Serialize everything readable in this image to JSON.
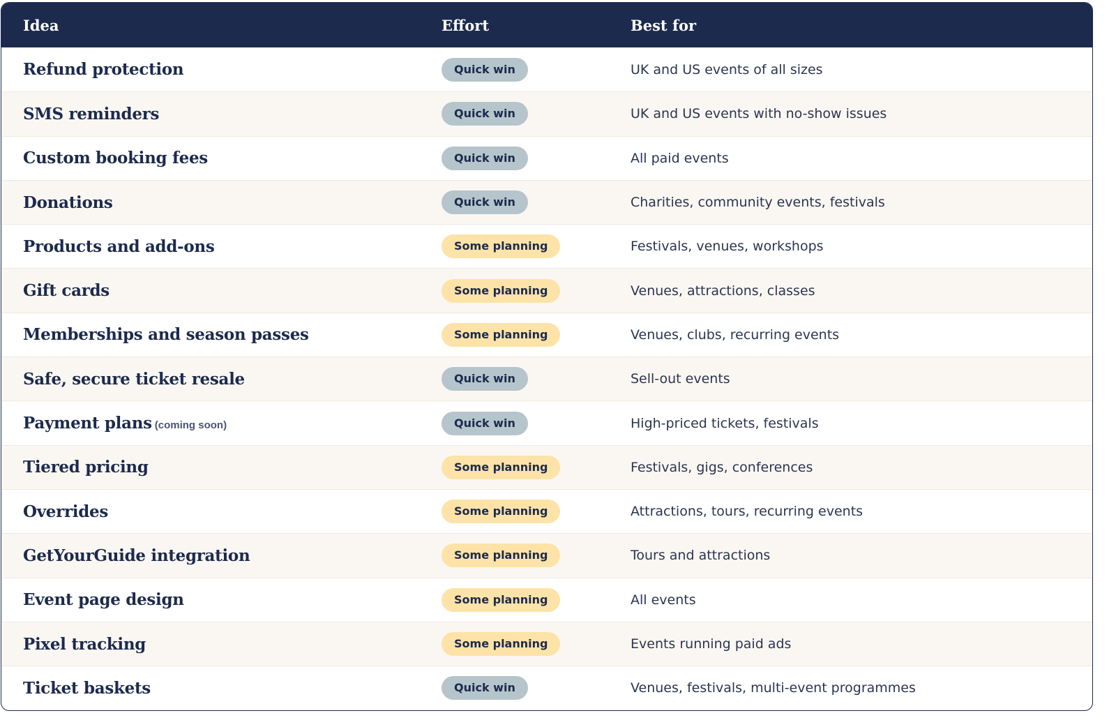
{
  "header": {
    "idea": "Idea",
    "effort": "Effort",
    "best_for": "Best for"
  },
  "colors": {
    "header_bg": "#1c2a4d",
    "quick_win_badge": "#b6c4cc",
    "some_planning_badge": "#fde3a7",
    "alt_row_bg": "#faf7f3"
  },
  "rows": [
    {
      "idea": "Refund protection",
      "note": "",
      "effort": "Quick win",
      "effort_type": "quick",
      "best_for": "UK and US events of all sizes"
    },
    {
      "idea": "SMS reminders",
      "note": "",
      "effort": "Quick win",
      "effort_type": "quick",
      "best_for": "UK and US events with no-show issues"
    },
    {
      "idea": "Custom booking fees",
      "note": "",
      "effort": "Quick win",
      "effort_type": "quick",
      "best_for": "All paid events"
    },
    {
      "idea": "Donations",
      "note": "",
      "effort": "Quick win",
      "effort_type": "quick",
      "best_for": "Charities, community events, festivals"
    },
    {
      "idea": "Products and add-ons",
      "note": "",
      "effort": "Some planning",
      "effort_type": "planning",
      "best_for": "Festivals, venues, workshops"
    },
    {
      "idea": "Gift cards",
      "note": "",
      "effort": "Some planning",
      "effort_type": "planning",
      "best_for": "Venues, attractions, classes"
    },
    {
      "idea": "Memberships and season passes",
      "note": "",
      "effort": "Some planning",
      "effort_type": "planning",
      "best_for": "Venues, clubs, recurring events"
    },
    {
      "idea": "Safe, secure ticket resale",
      "note": "",
      "effort": "Quick win",
      "effort_type": "quick",
      "best_for": "Sell-out events"
    },
    {
      "idea": "Payment plans",
      "note": "(coming soon)",
      "effort": "Quick win",
      "effort_type": "quick",
      "best_for": "High-priced tickets, festivals"
    },
    {
      "idea": "Tiered pricing",
      "note": "",
      "effort": "Some planning",
      "effort_type": "planning",
      "best_for": "Festivals, gigs, conferences"
    },
    {
      "idea": "Overrides",
      "note": "",
      "effort": "Some planning",
      "effort_type": "planning",
      "best_for": "Attractions, tours, recurring events"
    },
    {
      "idea": "GetYourGuide integration",
      "note": "",
      "effort": "Some planning",
      "effort_type": "planning",
      "best_for": "Tours and attractions"
    },
    {
      "idea": "Event page design",
      "note": "",
      "effort": "Some planning",
      "effort_type": "planning",
      "best_for": "All events"
    },
    {
      "idea": "Pixel tracking",
      "note": "",
      "effort": "Some planning",
      "effort_type": "planning",
      "best_for": "Events running paid ads"
    },
    {
      "idea": "Ticket baskets",
      "note": "",
      "effort": "Quick win",
      "effort_type": "quick",
      "best_for": "Venues, festivals, multi-event programmes"
    }
  ]
}
